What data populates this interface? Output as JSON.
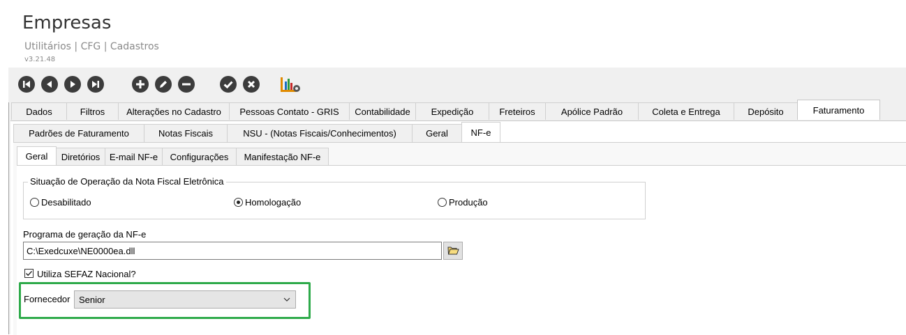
{
  "header": {
    "title": "Empresas",
    "subtitle": "Utilitários | CFG | Cadastros",
    "version": "v3.21.48"
  },
  "toolbar": {
    "buttons": [
      "first-icon",
      "previous-icon",
      "next-icon",
      "last-icon",
      "add-icon",
      "edit-icon",
      "remove-icon",
      "confirm-icon",
      "cancel-icon",
      "report-chart-icon"
    ]
  },
  "tabs_main": [
    {
      "label": "Dados"
    },
    {
      "label": "Filtros"
    },
    {
      "label": "Alterações no Cadastro"
    },
    {
      "label": "Pessoas Contato - GRIS"
    },
    {
      "label": "Contabilidade"
    },
    {
      "label": "Expedição"
    },
    {
      "label": "Freteiros"
    },
    {
      "label": "Apólice Padrão"
    },
    {
      "label": "Coleta e Entrega"
    },
    {
      "label": "Depósito"
    },
    {
      "label": "Faturamento"
    }
  ],
  "tabs_sub": [
    {
      "label": "Padrões de Faturamento"
    },
    {
      "label": "Notas Fiscais"
    },
    {
      "label": "NSU - (Notas Fiscais/Conhecimentos)"
    },
    {
      "label": "Geral"
    },
    {
      "label": "NF-e"
    }
  ],
  "tabs_nfe": [
    {
      "label": "Geral"
    },
    {
      "label": "Diretórios"
    },
    {
      "label": "E-mail NF-e"
    },
    {
      "label": "Configurações"
    },
    {
      "label": "Manifestação NF-e"
    }
  ],
  "situacao": {
    "legend": "Situação de Operação da Nota Fiscal Eletrônica",
    "options": [
      {
        "label": "Desabilitado",
        "selected": false
      },
      {
        "label": "Homologação",
        "selected": true
      },
      {
        "label": "Produção",
        "selected": false
      }
    ]
  },
  "programa": {
    "label": "Programa de geração da NF-e",
    "value": "C:\\Exedcuxe\\NE0000ea.dll"
  },
  "sefaz": {
    "label": "Utiliza SEFAZ Nacional?",
    "checked": true
  },
  "fornecedor": {
    "label": "Fornecedor",
    "value": "Senior"
  },
  "colors": {
    "highlight": "#2eaa4a",
    "toolbar_icon": "#3c3c3c"
  }
}
